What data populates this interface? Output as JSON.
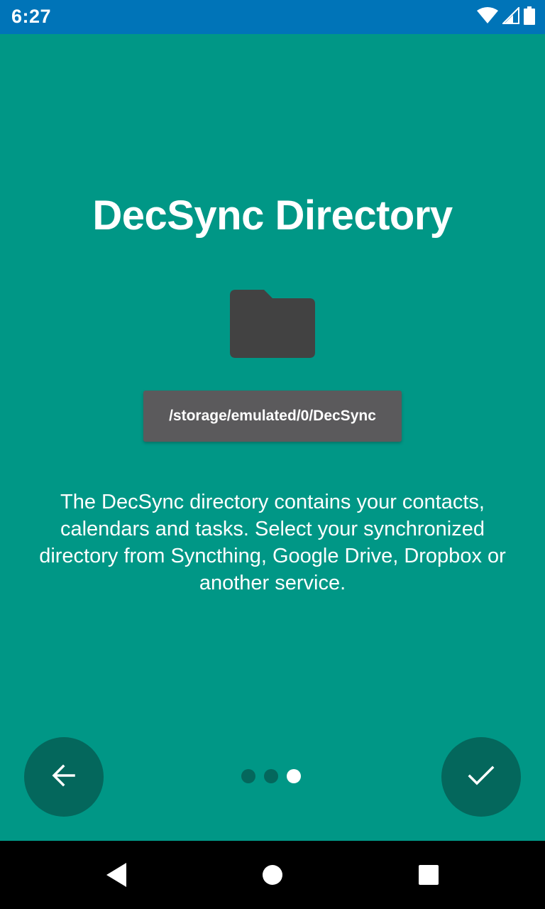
{
  "status_bar": {
    "time": "6:27",
    "icons": [
      "wifi-icon",
      "cellular-signal-icon",
      "battery-icon"
    ]
  },
  "screen": {
    "title": "DecSync Directory",
    "folder_icon": "folder-icon",
    "directory_path": "/storage/emulated/0/DecSync",
    "description": "The DecSync directory contains your contacts, calendars and tasks. Select your synchronized directory from Syncthing, Google Drive, Dropbox or another service."
  },
  "navigation": {
    "back_icon": "arrow-back-icon",
    "done_icon": "check-icon",
    "page_indicator": {
      "total": 3,
      "current": 3
    }
  },
  "system_nav": {
    "icons": [
      "back-triangle-icon",
      "home-circle-icon",
      "recents-square-icon"
    ]
  },
  "colors": {
    "background": "#009786",
    "status_bar": "#0074b8",
    "fab": "#04675c",
    "path_button": "#5b5a5c",
    "folder": "#424242"
  }
}
